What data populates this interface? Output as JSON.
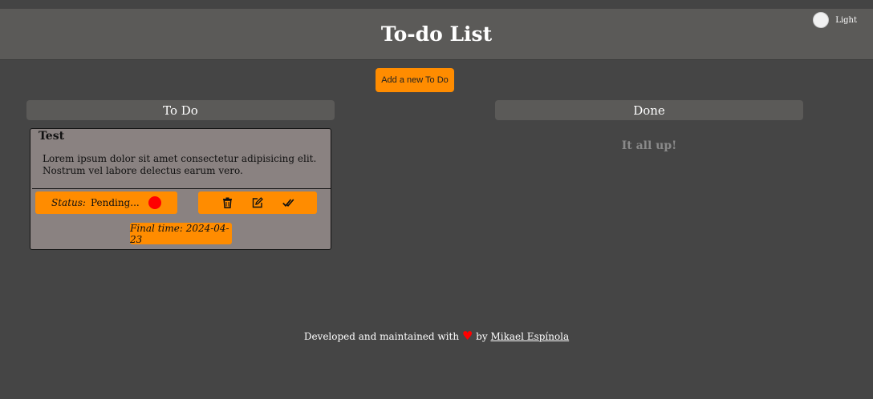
{
  "header": {
    "title": "To-do List",
    "theme_toggle_label": "Light"
  },
  "toolbar": {
    "add_label": "Add a new To Do"
  },
  "columns": {
    "todo": {
      "title": "To Do"
    },
    "done": {
      "title": "Done",
      "empty_message": "It all up!"
    }
  },
  "todos": [
    {
      "title": "Test",
      "description": "Lorem ipsum dolor sit amet consectetur adipisicing elit. Nostrum vel labore delectus earum vero.",
      "status_key": "Status:",
      "status_value": "Pending...",
      "final_time": "Final time: 2024-04-23"
    }
  ],
  "footer": {
    "text_before": "Developed and maintained with",
    "heart": "♥",
    "text_by": "by",
    "author": "Mikael Espínola"
  },
  "icons": {
    "theme": "circle-toggle-icon",
    "status": "red-dot-icon",
    "delete": "trash-icon",
    "edit": "edit-icon",
    "complete": "double-check-icon",
    "heart": "heart-icon"
  },
  "colors": {
    "background": "#454545",
    "header": "#5b5a58",
    "accent": "#ff8c00",
    "card": "#8a8281",
    "status_pending": "#ff0000"
  }
}
